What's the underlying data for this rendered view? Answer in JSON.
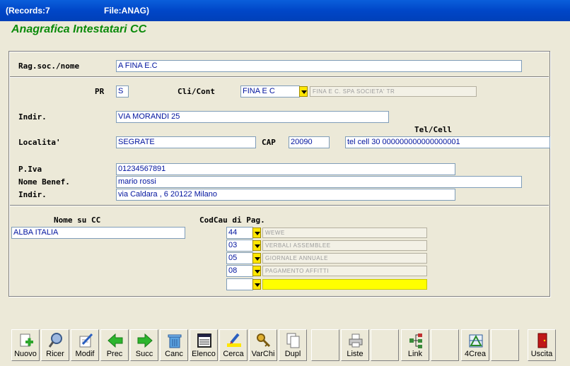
{
  "titlebar": {
    "records": "(Records:7",
    "file": "File:ANAG)"
  },
  "form": {
    "title": "Anagrafica Intestatari CC",
    "labels": {
      "ragsoc": "Rag.soc./nome",
      "pr": "PR",
      "clicont": "Cli/Cont",
      "indir": "Indir.",
      "localita": "Localita'",
      "cap": "CAP",
      "telcell": "Tel/Cell",
      "piva": "P.Iva",
      "nomebenef": "Nome Benef.",
      "indir2": "Indir.",
      "nomesucc": "Nome su CC",
      "codcau": "CodCau di Pag."
    },
    "values": {
      "ragsoc": "A  FINA E.C",
      "pr": "S",
      "clicont": "FINA E C",
      "clicont_desc": "FINA E C. SPA SOCIETA' TR",
      "indir": "VIA MORANDI 25",
      "localita": "SEGRATE",
      "cap": "20090",
      "telcell": "tel cell 30 000000000000000001",
      "piva": "01234567891",
      "nomebenef": "mario rossi",
      "indir2": "via Caldara , 6   20122 Milano",
      "nomesucc": "ALBA ITALIA"
    },
    "codcau_rows": [
      {
        "code": "44",
        "desc": "WEWE"
      },
      {
        "code": "03",
        "desc": "VERBALI ASSEMBLEE"
      },
      {
        "code": "05",
        "desc": "GIORNALE ANNUALE"
      },
      {
        "code": "08",
        "desc": "PAGAMENTO AFFITTI"
      },
      {
        "code": "",
        "desc": ""
      }
    ]
  },
  "toolbar": {
    "nuovo": "Nuovo",
    "ricer": "Ricer",
    "modif": "Modif",
    "prec": "Prec",
    "succ": "Succ",
    "canc": "Canc",
    "elenco": "Elenco",
    "cerca": "Cerca",
    "varchi": "VarChi",
    "dupl": "Dupl",
    "liste": "Liste",
    "link": "Link",
    "crea": "4Crea",
    "uscita": "Uscita"
  },
  "colors": {
    "title_green": "#0A8A0A",
    "field_text": "#00139E",
    "highlight_yellow": "#FFFF00",
    "titlebar_blue": "#0046C8"
  }
}
